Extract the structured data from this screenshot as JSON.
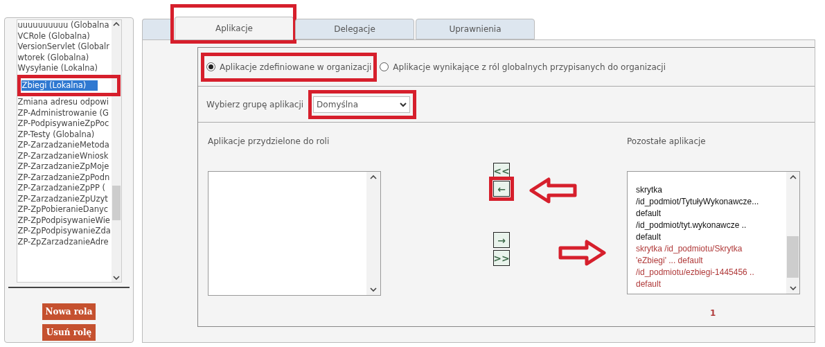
{
  "roles": {
    "items": [
      {
        "label": "uuuuuuuuuu (Globalna",
        "selected": false
      },
      {
        "label": "VCRole (Globalna)",
        "selected": false
      },
      {
        "label": "VersionServlet (Globalr",
        "selected": false
      },
      {
        "label": "wtorek (Globalna)",
        "selected": false
      },
      {
        "label": "Wysyłanie (Lokalna)",
        "selected": false
      },
      {
        "label": "Zbiegi (Lokalna)",
        "selected": true
      },
      {
        "label": "Zmiana adresu odpowi",
        "selected": false
      },
      {
        "label": "ZP-Administrowanie (G",
        "selected": false
      },
      {
        "label": "ZP-PodpisywanieZpPoc",
        "selected": false
      },
      {
        "label": "ZP-Testy (Globalna)",
        "selected": false
      },
      {
        "label": "ZP-ZarzadzanieMetoda",
        "selected": false
      },
      {
        "label": "ZP-ZarzadzanieWniosk",
        "selected": false
      },
      {
        "label": "ZP-ZarzadzanieZpMoje",
        "selected": false
      },
      {
        "label": "ZP-ZarzadzanieZpPodn",
        "selected": false
      },
      {
        "label": "ZP-ZarzadzanieZpPP (",
        "selected": false
      },
      {
        "label": "ZP-ZarzadzanieZpUzyt",
        "selected": false
      },
      {
        "label": "ZP-ZpPobieranieDanyc",
        "selected": false
      },
      {
        "label": "ZP-ZpPodpisywanieWie",
        "selected": false
      },
      {
        "label": "ZP-ZpPodpisywanieZda",
        "selected": false
      },
      {
        "label": "ZP-ZpZarzadzanieAdre",
        "selected": false
      }
    ],
    "buttons": [
      "Nowa rola",
      "Usuń rolę"
    ]
  },
  "tabs": [
    {
      "label": "Aplikacje",
      "selected": true
    },
    {
      "label": "Delegacje",
      "selected": false
    },
    {
      "label": "Uprawnienia",
      "selected": false
    }
  ],
  "source_options": [
    {
      "label": "Aplikacje zdefiniowane w organizacji",
      "selected": true
    },
    {
      "label": "Aplikacje wynikające z ról globalnych przypisanych do organizacji",
      "selected": false
    }
  ],
  "group_select": {
    "label": "Wybierz grupę aplikacji",
    "value": "Domyślna"
  },
  "assigned": {
    "title": "Aplikacje przydzielone do roli"
  },
  "move_buttons": [
    {
      "kind": "all_left",
      "label": "<<"
    },
    {
      "kind": "left",
      "label": "←"
    },
    {
      "kind": "right",
      "label": "→"
    },
    {
      "kind": "all_right",
      "label": ">>"
    }
  ],
  "remaining": {
    "title": "Pozostałe aplikacje",
    "lines": [
      {
        "text": "skrytka",
        "highlighted": false
      },
      {
        "text": "/id_podmiot/TytułyWykonawcze...",
        "highlighted": false
      },
      {
        "text": "default",
        "highlighted": false
      },
      {
        "text": "/id_podmiot/tyt.wykonawcze ..",
        "highlighted": false
      },
      {
        "text": "default",
        "highlighted": false
      },
      {
        "text": "skrytka /id_podmiotu/Skrytka",
        "highlighted": true
      },
      {
        "text": "'eZbiegi' ... default",
        "highlighted": true
      },
      {
        "text": "/id_podmiotu/ezbiegi-1445456 ..",
        "highlighted": true
      },
      {
        "text": "default",
        "highlighted": true
      }
    ],
    "page": "1"
  }
}
